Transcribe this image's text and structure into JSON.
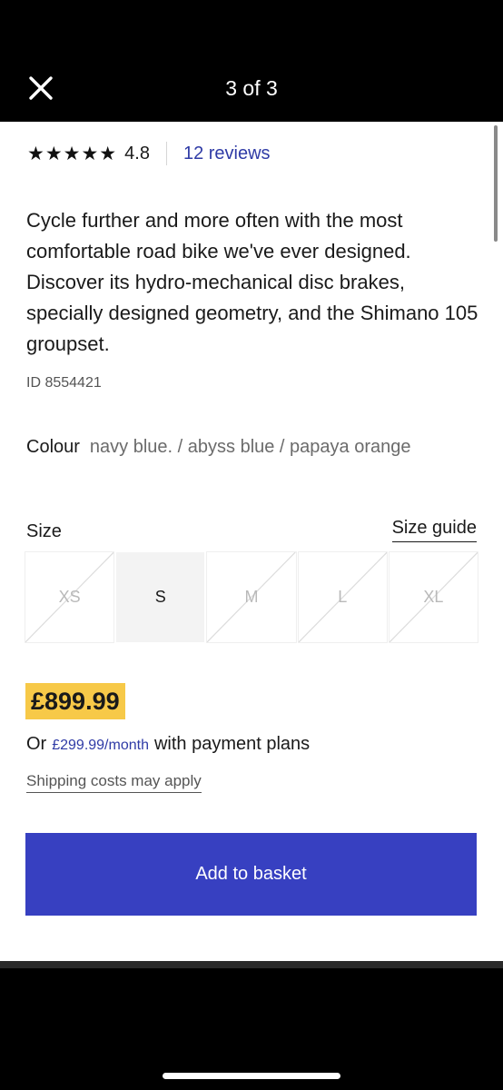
{
  "header": {
    "counter": "3 of 3",
    "close_icon": "close-icon"
  },
  "rating": {
    "stars": "★★★★★",
    "value": "4.8",
    "reviews_label": "12 reviews"
  },
  "product": {
    "description": "Cycle further and more often with the most comfortable road bike we've ever designed. Discover its hydro-mechanical disc brakes, specially designed geometry, and the Shimano 105 groupset.",
    "id_text": "ID 8554421",
    "colour_label": "Colour",
    "colour_value": "navy blue. / abyss blue / papaya orange"
  },
  "sizes": {
    "label": "Size",
    "guide_label": "Size guide",
    "options": [
      {
        "label": "XS",
        "available": false
      },
      {
        "label": "S",
        "available": true
      },
      {
        "label": "M",
        "available": false
      },
      {
        "label": "L",
        "available": false
      },
      {
        "label": "XL",
        "available": false
      }
    ]
  },
  "pricing": {
    "price": "£899.99",
    "payment_or": "Or",
    "payment_monthly": "£299.99/month",
    "payment_suffix": "with payment plans",
    "shipping_note": "Shipping costs may apply"
  },
  "actions": {
    "add_to_basket": "Add to basket"
  },
  "colors": {
    "primary_button": "#3740c1",
    "price_highlight": "#f7c948",
    "link": "#2f3ba6"
  }
}
